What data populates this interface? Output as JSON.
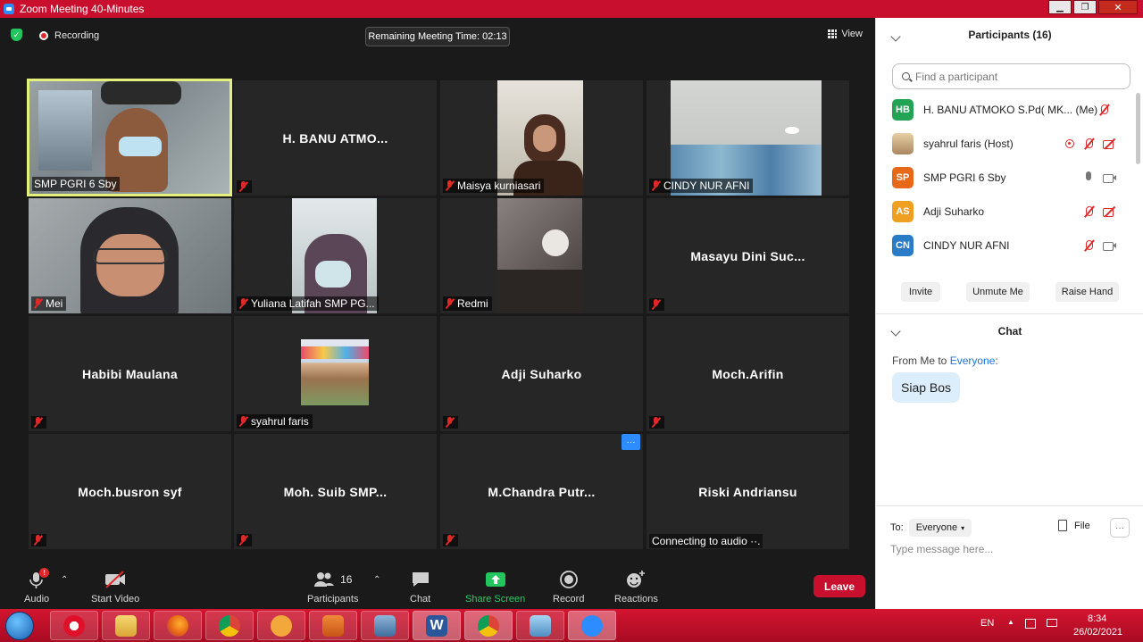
{
  "window": {
    "title": "Zoom Meeting 40-Minutes",
    "minimize": "▁",
    "restore": "❐",
    "close": "✕"
  },
  "topbar": {
    "recording": "Recording",
    "remaining_time": "Remaining Meeting Time: 02:13",
    "view": "View"
  },
  "tiles": [
    {
      "name": "SMP PGRI 6 Sby",
      "type": "video",
      "active": true,
      "muted": false
    },
    {
      "name": "H. BANU ATMO...",
      "type": "name",
      "muted": true
    },
    {
      "name": "Maisya kurniasari",
      "type": "video",
      "muted": true
    },
    {
      "name": "CINDY NUR AFNI",
      "type": "video",
      "muted": true
    },
    {
      "name": "Mei",
      "type": "video",
      "muted": true
    },
    {
      "name": "Yuliana Latifah SMP PG...",
      "type": "video",
      "muted": true
    },
    {
      "name": "Redmi",
      "type": "video",
      "muted": true
    },
    {
      "name": "Masayu Dini Suc...",
      "type": "name",
      "muted": true
    },
    {
      "name": "Habibi Maulana",
      "type": "name",
      "muted": true
    },
    {
      "name": "syahrul faris",
      "type": "video",
      "muted": true
    },
    {
      "name": "Adji Suharko",
      "type": "name",
      "muted": true
    },
    {
      "name": "Moch.Arifin",
      "type": "name",
      "muted": true
    },
    {
      "name": "Moch.busron syf",
      "type": "name",
      "muted": true
    },
    {
      "name": "Moh. Suib SMP...",
      "type": "name",
      "muted": true
    },
    {
      "name": "M.Chandra Putr...",
      "type": "name",
      "muted": true,
      "more": "···"
    },
    {
      "name": "Riski Andriansu",
      "type": "name",
      "muted": false,
      "status": "Connecting to audio ··."
    }
  ],
  "toolbar": {
    "audio": "Audio",
    "audio_badge": "!",
    "start_video": "Start Video",
    "participants_count": "16",
    "participants": "Participants",
    "chat": "Chat",
    "share_screen": "Share Screen",
    "record": "Record",
    "reactions": "Reactions",
    "leave": "Leave"
  },
  "participants_panel": {
    "title": "Participants (16)",
    "search_placeholder": "Find a participant",
    "list": [
      {
        "initials": "HB",
        "color": "#23a455",
        "name": "H. BANU ATMOKO     S.Pd( MK...  (Me)"
      },
      {
        "initials": "",
        "color": "#8a8a8a",
        "name": "syahrul faris (Host)"
      },
      {
        "initials": "SP",
        "color": "#e8681a",
        "name": "SMP PGRI 6 Sby"
      },
      {
        "initials": "AS",
        "color": "#f0a020",
        "name": "Adji Suharko"
      },
      {
        "initials": "CN",
        "color": "#2a7bc8",
        "name": "CINDY NUR AFNI"
      }
    ],
    "invite": "Invite",
    "unmute_me": "Unmute Me",
    "raise_hand": "Raise Hand"
  },
  "chat_panel": {
    "title": "Chat",
    "from": "From Me to ",
    "to": "Everyone",
    "colon": ":",
    "message": "Siap Bos",
    "to_label": "To:",
    "to_value": "Everyone",
    "file": "File",
    "more": "···",
    "input_placeholder": "Type message here..."
  },
  "taskbar": {
    "lang": "EN",
    "time": "8:34",
    "date": "26/02/2021"
  }
}
